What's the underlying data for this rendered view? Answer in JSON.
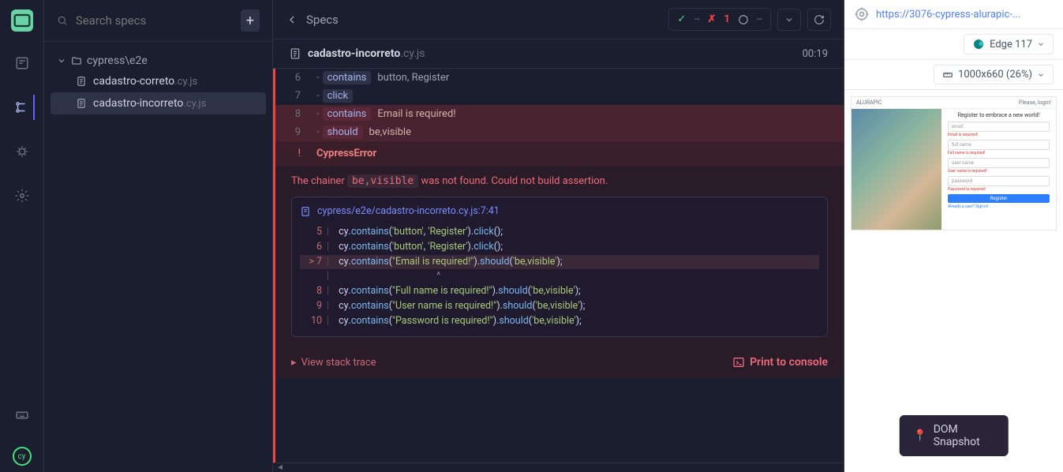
{
  "search": {
    "placeholder": "Search specs"
  },
  "tree": {
    "folder": "cypress\\e2e",
    "files": [
      {
        "name": "cadastro-correto",
        "ext": ".cy.js",
        "active": false
      },
      {
        "name": "cadastro-incorreto",
        "ext": ".cy.js",
        "active": true
      }
    ]
  },
  "topbar": {
    "back": "Specs",
    "pass_dash": "--",
    "fail_count": "1",
    "pending_dash": "--"
  },
  "spec": {
    "name": "cadastro-incorreto",
    "ext": ".cy.js",
    "timer": "00:19"
  },
  "commands": [
    {
      "n": "6",
      "cmd": "contains",
      "args": "button, Register",
      "failed": false
    },
    {
      "n": "7",
      "cmd": "click",
      "args": "",
      "failed": false
    },
    {
      "n": "8",
      "cmd": "contains",
      "args": "Email is required!",
      "failed": true
    },
    {
      "n": "9",
      "cmd": "should",
      "args": "be,visible",
      "failed": true
    }
  ],
  "error": {
    "title": "CypressError",
    "msg_pre": "The chainer ",
    "msg_chal": "be,visible",
    "msg_post": " was not found. Could not build assertion.",
    "file": "cypress/e2e/cadastro-incorreto.cy.js:7:41",
    "lines": [
      {
        "n": "5",
        "hl": false,
        "parts": [
          {
            "t": "id",
            "v": "cy"
          },
          {
            "t": "p",
            "v": "."
          },
          {
            "t": "fn",
            "v": "contains"
          },
          {
            "t": "p",
            "v": "("
          },
          {
            "t": "str",
            "v": "'button'"
          },
          {
            "t": "p",
            "v": ", "
          },
          {
            "t": "str",
            "v": "'Register'"
          },
          {
            "t": "p",
            "v": ")."
          },
          {
            "t": "fn",
            "v": "click"
          },
          {
            "t": "p",
            "v": "();"
          }
        ]
      },
      {
        "n": "6",
        "hl": false,
        "parts": [
          {
            "t": "id",
            "v": "cy"
          },
          {
            "t": "p",
            "v": "."
          },
          {
            "t": "fn",
            "v": "contains"
          },
          {
            "t": "p",
            "v": "("
          },
          {
            "t": "str",
            "v": "'button'"
          },
          {
            "t": "p",
            "v": ", "
          },
          {
            "t": "str",
            "v": "'Register'"
          },
          {
            "t": "p",
            "v": ")."
          },
          {
            "t": "fn",
            "v": "click"
          },
          {
            "t": "p",
            "v": "();"
          }
        ]
      },
      {
        "n": "7",
        "hl": true,
        "parts": [
          {
            "t": "id",
            "v": "cy"
          },
          {
            "t": "p",
            "v": "."
          },
          {
            "t": "fn",
            "v": "contains"
          },
          {
            "t": "p",
            "v": "("
          },
          {
            "t": "str",
            "v": "\"Email is required!\""
          },
          {
            "t": "p",
            "v": ")."
          },
          {
            "t": "fn",
            "v": "should"
          },
          {
            "t": "p",
            "v": "("
          },
          {
            "t": "str",
            "v": "'be,visible'"
          },
          {
            "t": "p",
            "v": ");"
          }
        ]
      },
      {
        "n": "",
        "hl": false,
        "caret": "                                        ^"
      },
      {
        "n": "8",
        "hl": false,
        "parts": [
          {
            "t": "id",
            "v": "cy"
          },
          {
            "t": "p",
            "v": "."
          },
          {
            "t": "fn",
            "v": "contains"
          },
          {
            "t": "p",
            "v": "("
          },
          {
            "t": "str",
            "v": "\"Full name is required!\""
          },
          {
            "t": "p",
            "v": ")."
          },
          {
            "t": "fn",
            "v": "should"
          },
          {
            "t": "p",
            "v": "("
          },
          {
            "t": "str",
            "v": "'be,visible'"
          },
          {
            "t": "p",
            "v": ");"
          }
        ]
      },
      {
        "n": "9",
        "hl": false,
        "parts": [
          {
            "t": "id",
            "v": "cy"
          },
          {
            "t": "p",
            "v": "."
          },
          {
            "t": "fn",
            "v": "contains"
          },
          {
            "t": "p",
            "v": "("
          },
          {
            "t": "str",
            "v": "\"User name is required!\""
          },
          {
            "t": "p",
            "v": ")."
          },
          {
            "t": "fn",
            "v": "should"
          },
          {
            "t": "p",
            "v": "("
          },
          {
            "t": "str",
            "v": "'be,visible'"
          },
          {
            "t": "p",
            "v": ");"
          }
        ]
      },
      {
        "n": "10",
        "hl": false,
        "parts": [
          {
            "t": "id",
            "v": "cy"
          },
          {
            "t": "p",
            "v": "."
          },
          {
            "t": "fn",
            "v": "contains"
          },
          {
            "t": "p",
            "v": "("
          },
          {
            "t": "str",
            "v": "\"Password is required!\""
          },
          {
            "t": "p",
            "v": ")."
          },
          {
            "t": "fn",
            "v": "should"
          },
          {
            "t": "p",
            "v": "("
          },
          {
            "t": "str",
            "v": "'be,visible'"
          },
          {
            "t": "p",
            "v": ");"
          }
        ]
      }
    ],
    "view_stack": "View stack trace",
    "print": "Print to console"
  },
  "preview": {
    "url": "https://3076-cypress-alurapic-...",
    "browser": "Edge 117",
    "viewport": "1000x660 (26%)",
    "brand": "ALURAPIC",
    "login": "Please, login!",
    "title": "Register to embrace a new world!",
    "fields": [
      {
        "placeholder": "email",
        "err": "Email is required!"
      },
      {
        "placeholder": "full name",
        "err": "Full name is required!"
      },
      {
        "placeholder": "user name",
        "err": "User name is required!"
      },
      {
        "placeholder": "password",
        "err": "Password is required!"
      }
    ],
    "button": "Register",
    "link": "Already a user? Sign in!",
    "snapshot": "DOM Snapshot"
  }
}
